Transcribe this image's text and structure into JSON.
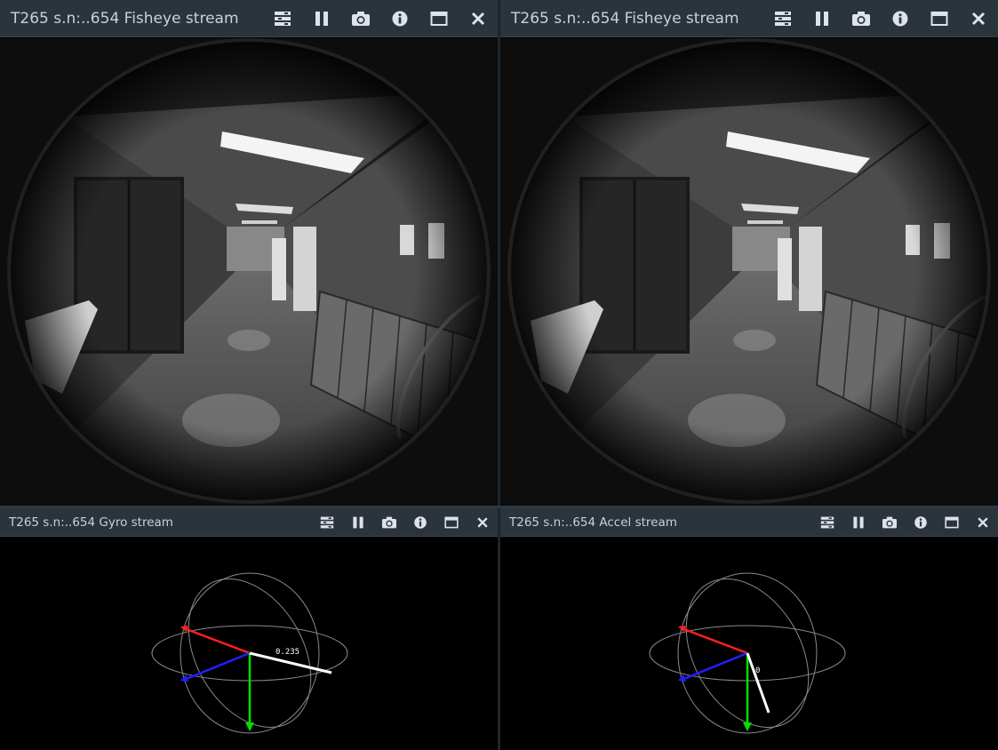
{
  "panels": {
    "fisheye_left": {
      "title": "T265 s.n:..654 Fisheye stream"
    },
    "fisheye_right": {
      "title": "T265 s.n:..654 Fisheye stream"
    },
    "gyro": {
      "title": "T265 s.n:..654 Gyro stream",
      "value_label": "0.235"
    },
    "accel": {
      "title": "T265 s.n:..654 Accel stream",
      "value_label": "0"
    }
  },
  "toolbar_icons": [
    "options-icon",
    "pause-icon",
    "camera-icon",
    "info-icon",
    "maximize-icon",
    "close-icon"
  ],
  "colors": {
    "titlebar": "#2b333b",
    "title_text": "#c9d1d9",
    "axis_x": "#ff2020",
    "axis_y": "#00e000",
    "axis_z": "#2020ff",
    "vector": "#ffffff",
    "sphere": "#8a8a8a"
  }
}
